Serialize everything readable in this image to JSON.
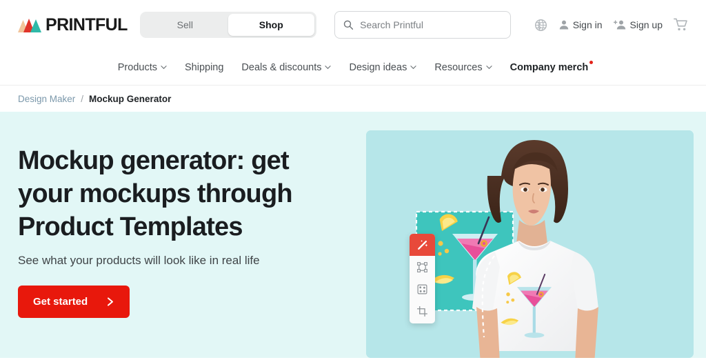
{
  "header": {
    "logo": {
      "name": "printful-logo",
      "wordmark": "PRINTFUL",
      "colors": [
        "#f2c49a",
        "#e0342a",
        "#2fb9a8"
      ]
    },
    "segmented": {
      "name": "sell-shop-toggle",
      "items": [
        {
          "label": "Sell",
          "active": false
        },
        {
          "label": "Shop",
          "active": true
        }
      ]
    },
    "search": {
      "placeholder": "Search Printful",
      "value": "",
      "icon": "search-icon"
    },
    "account": {
      "globe_icon": "globe-icon",
      "signin_label": "Sign in",
      "signin_icon": "person-icon",
      "signup_label": "Sign up",
      "signup_icon": "person-add-icon",
      "cart_icon": "shopping-cart-icon"
    }
  },
  "nav": {
    "items": [
      {
        "label": "Products",
        "has_chevron": true,
        "strong": false,
        "dot": false
      },
      {
        "label": "Shipping",
        "has_chevron": false,
        "strong": false,
        "dot": false
      },
      {
        "label": "Deals & discounts",
        "has_chevron": true,
        "strong": false,
        "dot": false
      },
      {
        "label": "Design ideas",
        "has_chevron": true,
        "strong": false,
        "dot": false
      },
      {
        "label": "Resources",
        "has_chevron": true,
        "strong": false,
        "dot": false
      },
      {
        "label": "Company merch",
        "has_chevron": false,
        "strong": true,
        "dot": true
      }
    ]
  },
  "breadcrumb": {
    "parent": "Design Maker",
    "separator": "/",
    "current": "Mockup Generator"
  },
  "hero": {
    "heading": "Mockup generator: get your mockups through Product Templates",
    "subheading": "See what your products will look like in real life",
    "cta_label": "Get started",
    "cta_icon": "chevron-right-icon",
    "cta_color": "#e8180c",
    "background_color": "#e2f7f6",
    "artwork": {
      "panel_color": "#b6e6e9",
      "design_panel_color": "#3ec5bd",
      "selection_border": "dashed-white",
      "cursor_icon": "grab-hand-cursor",
      "design_name": "cocktail-martini-graphic",
      "model_description": "woman wearing white t-shirt with cocktail print",
      "toolbar": {
        "tools": [
          {
            "name": "magic-wand-icon",
            "active": true
          },
          {
            "name": "transform-nodes-icon",
            "active": false
          },
          {
            "name": "pattern-square-icon",
            "active": false
          },
          {
            "name": "crop-icon",
            "active": false
          }
        ]
      }
    }
  }
}
